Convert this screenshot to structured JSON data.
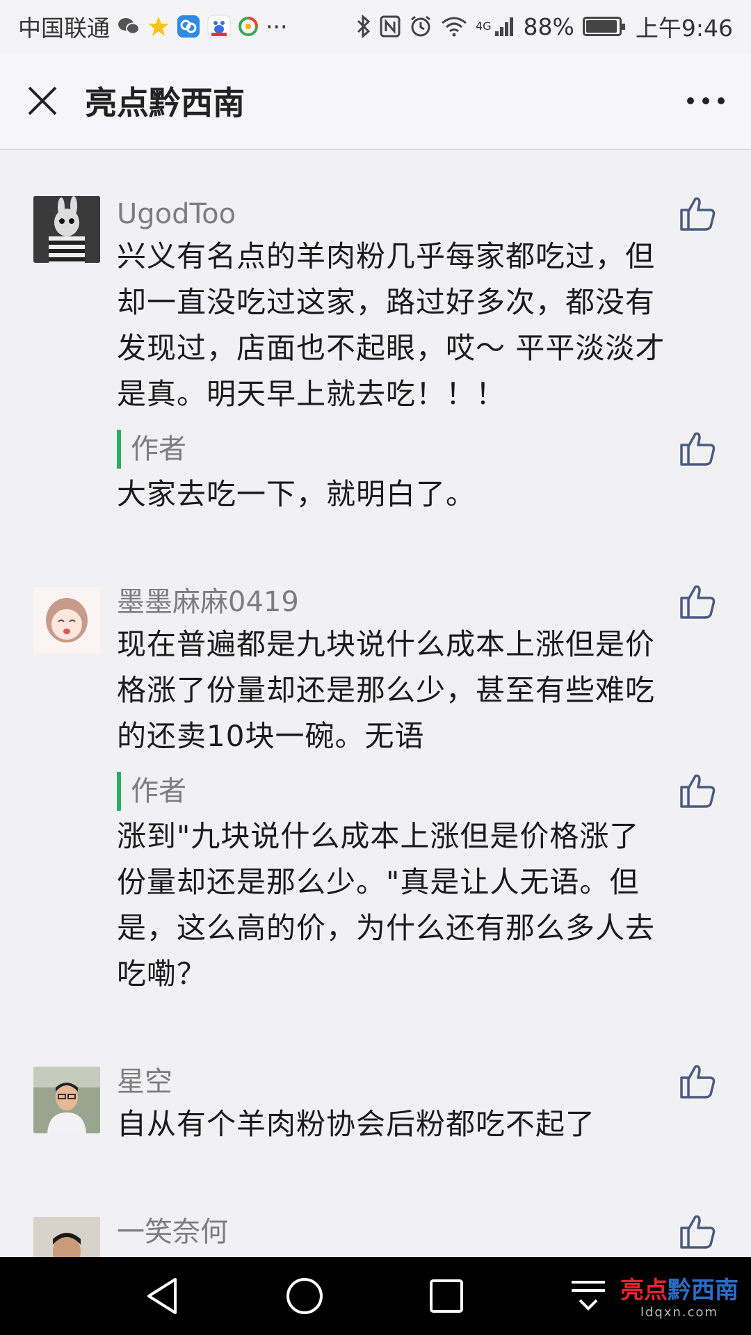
{
  "status_bar": {
    "carrier": "中国联通",
    "more": "···",
    "network": "4G",
    "battery": "88%",
    "time": "上午9:46"
  },
  "app_bar": {
    "title": "亮点黔西南"
  },
  "comments": [
    {
      "nick": "UgodToo",
      "text": "兴义有名点的羊肉粉几乎每家都吃过，但却一直没吃过这家，路过好多次，都没有发现过，店面也不起眼，哎～ 平平淡淡才是真。明天早上就去吃！！！",
      "reply_tag": "作者",
      "reply_text": "大家去吃一下，就明白了。"
    },
    {
      "nick": "墨墨麻麻0419",
      "text": "现在普遍都是九块说什么成本上涨但是价格涨了份量却还是那么少，甚至有些难吃的还卖10块一碗。无语",
      "reply_tag": "作者",
      "reply_text": "涨到\"九块说什么成本上涨但是价格涨了份量却还是那么少。\"真是让人无语。但是，这么高的价，为什么还有那么多人去吃嘞？"
    },
    {
      "nick": "星空",
      "text": "自从有个羊肉粉协会后粉都吃不起了"
    },
    {
      "nick": "一笑奈何"
    }
  ],
  "watermark": {
    "main_a": "亮点",
    "main_b": "黔西南",
    "sub": "ldqxn.com"
  },
  "colors": {
    "accent_green": "#2aae67",
    "background": "#f1f1f3"
  }
}
